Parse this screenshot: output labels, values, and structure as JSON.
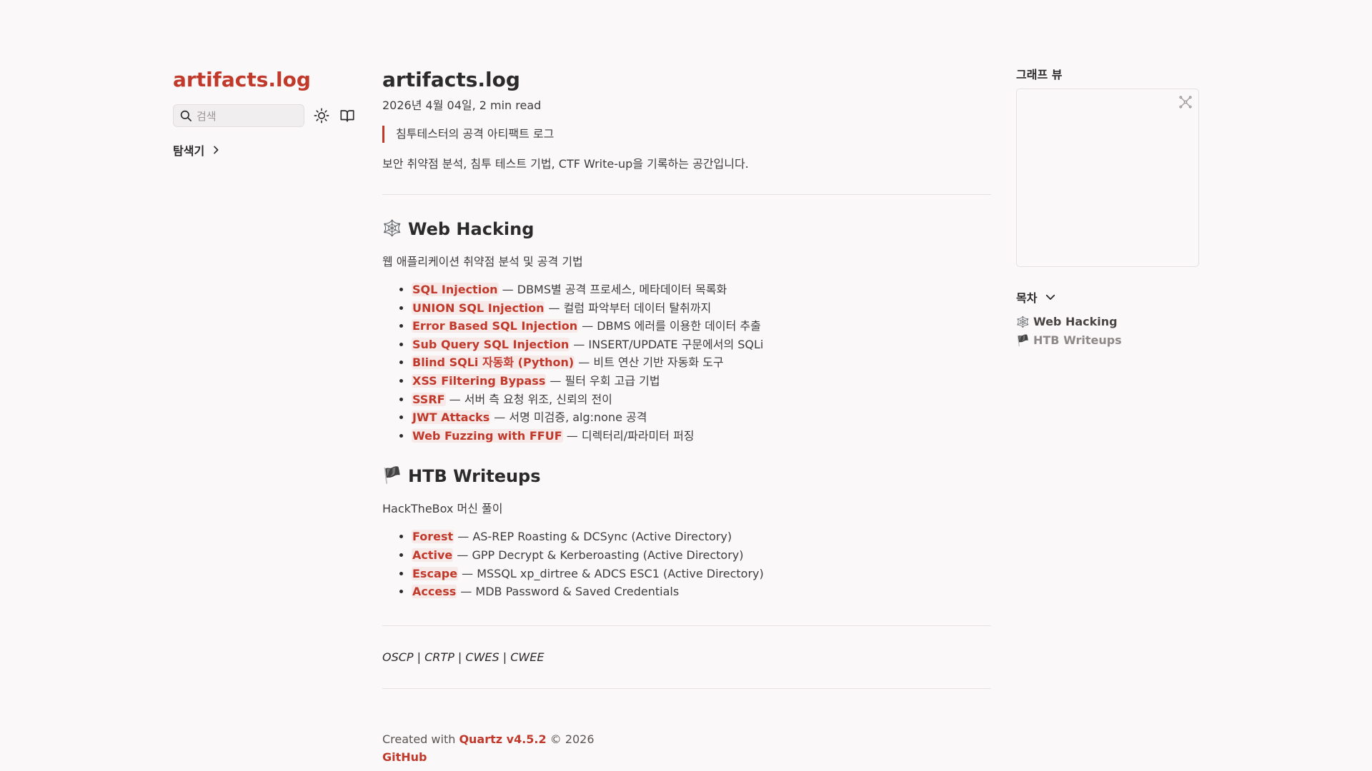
{
  "sidebar": {
    "site_title": "artifacts.log",
    "search_placeholder": "검색",
    "explorer_label": "탐색기"
  },
  "page": {
    "title": "artifacts.log",
    "meta": "2026년 4월 04일, 2 min read",
    "quote": "침투테스터의 공격 아티팩트 로그",
    "intro": "보안 취약점 분석, 침투 테스트 기법, CTF Write-up을 기록하는 공간입니다."
  },
  "sections": [
    {
      "emoji": "🕸️",
      "title": "Web Hacking",
      "desc": "웹 애플리케이션 취약점 분석 및 공격 기법",
      "items": [
        {
          "link": "SQL Injection",
          "desc": " — DBMS별 공격 프로세스, 메타데이터 목록화"
        },
        {
          "link": "UNION SQL Injection",
          "desc": " — 컬럼 파악부터 데이터 탈취까지"
        },
        {
          "link": "Error Based SQL Injection",
          "desc": " — DBMS 에러를 이용한 데이터 추출"
        },
        {
          "link": "Sub Query SQL Injection",
          "desc": " — INSERT/UPDATE 구문에서의 SQLi"
        },
        {
          "link": "Blind SQLi 자동화 (Python)",
          "desc": " — 비트 연산 기반 자동화 도구"
        },
        {
          "link": "XSS Filtering Bypass",
          "desc": " — 필터 우회 고급 기법"
        },
        {
          "link": "SSRF",
          "desc": " — 서버 측 요청 위조, 신뢰의 전이"
        },
        {
          "link": "JWT Attacks",
          "desc": " — 서명 미검증, alg:none 공격"
        },
        {
          "link": "Web Fuzzing with FFUF",
          "desc": " — 디렉터리/파라미터 퍼징"
        }
      ]
    },
    {
      "emoji": "🏴",
      "title": "HTB Writeups",
      "desc": "HackTheBox 머신 풀이",
      "items": [
        {
          "link": "Forest",
          "desc": " — AS-REP Roasting & DCSync (Active Directory)"
        },
        {
          "link": "Active",
          "desc": " — GPP Decrypt & Kerberoasting (Active Directory)"
        },
        {
          "link": "Escape",
          "desc": " — MSSQL xp_dirtree & ADCS ESC1 (Active Directory)"
        },
        {
          "link": "Access",
          "desc": " — MDB Password & Saved Credentials"
        }
      ]
    }
  ],
  "certs": "OSCP | CRTP | CWES | CWEE",
  "footer": {
    "created_prefix": "Created with ",
    "quartz_link": "Quartz v4.5.2",
    "copyright": " © 2026",
    "github_link": "GitHub"
  },
  "right": {
    "graph_title": "그래프 뷰",
    "toc_title": "목차",
    "toc_items": [
      {
        "emoji": "🕸️",
        "label": "Web Hacking"
      },
      {
        "emoji": "🏴",
        "label": "HTB Writeups"
      }
    ]
  },
  "colors": {
    "accent": "#c0392b",
    "highlight_bg": "#f8e9e9",
    "background": "#faf8f8"
  }
}
